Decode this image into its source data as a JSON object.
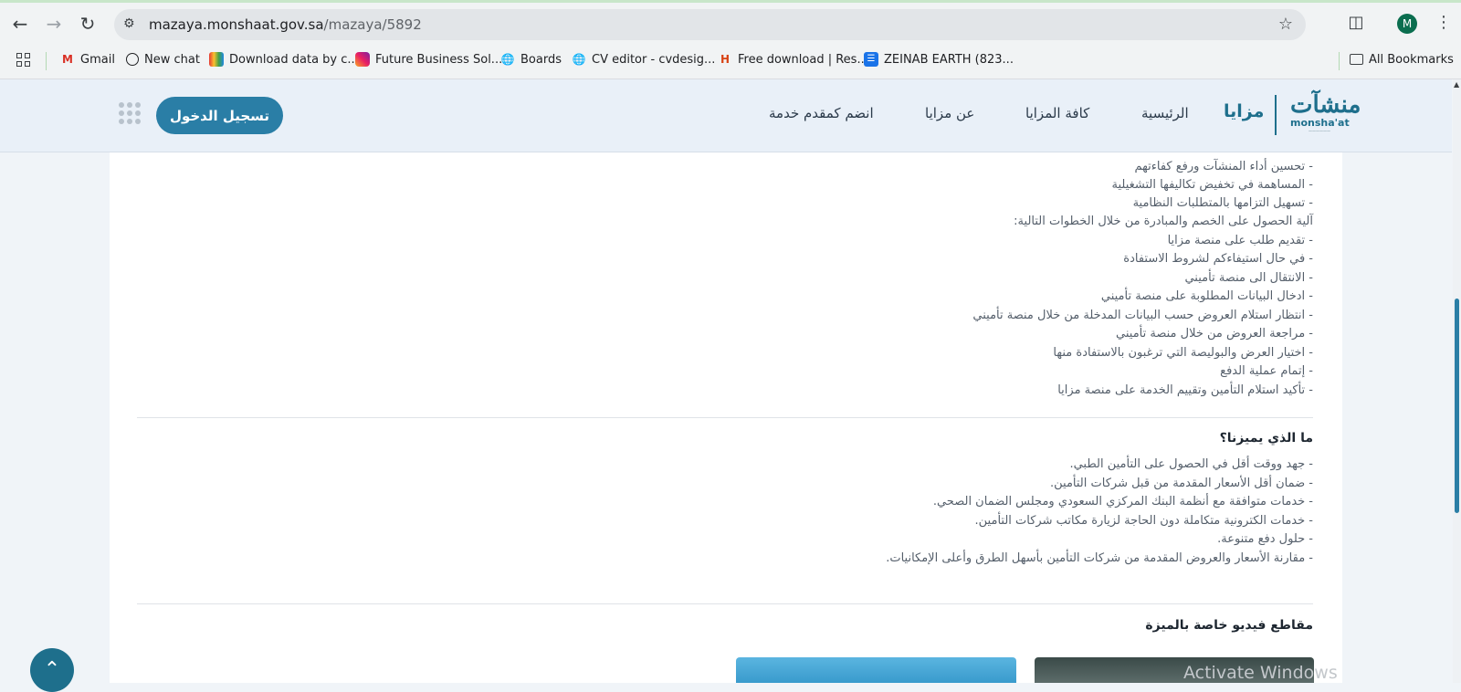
{
  "browser": {
    "url_domain": "mazaya.monshaat.gov.sa",
    "url_path": "/mazaya/5892",
    "profile_initial": "M",
    "bookmarks": [
      "Gmail",
      "New chat",
      "Download data by c...",
      "Future Business Sol...",
      "Boards",
      "CV editor - cvdesig...",
      "Free download | Res...",
      "ZEINAB EARTH (823..."
    ],
    "all_bookmarks": "All Bookmarks"
  },
  "header": {
    "logo_ar": "منشآت",
    "logo_en": "monsha'at",
    "brand": "مزايا",
    "menu": [
      "الرئيسية",
      "كافة المزايا",
      "عن مزايا",
      "انضم كمقدم خدمة"
    ],
    "login": "تسجيل الدخول"
  },
  "content": {
    "list1": [
      "- تحسين أداء المنشآت ورفع كفاءتهم",
      "- المساهمة في تخفيض تكاليفها التشغيلية",
      "- تسهيل التزامها بالمتطلبات النظامية",
      "آلية الحصول على الخصم والمبادرة من خلال الخطوات التالية:",
      "- تقديم طلب على منصة مزايا",
      "- في حال استيفاءكم لشروط الاستفادة",
      "- الانتقال الى منصة تأميني",
      "- ادخال البيانات المطلوبة على منصة تأميني",
      "- انتظار استلام العروض حسب البيانات المدخلة من خلال منصة تأميني",
      "- مراجعة العروض من خلال منصة تأميني",
      "- اختيار العرض والبوليصة التي ترغبون بالاستفادة منها",
      "- إتمام عملية الدفع",
      "- تأكيد استلام التأمين وتقييم الخدمة على منصة مزايا"
    ],
    "section2_title": "ما الذي يميزنا؟",
    "list2": [
      "- جهد ووقت أقل في الحصول على التأمين الطبي.",
      "- ضمان أقل الأسعار المقدمة من قبل شركات التأمين.",
      "- خدمات متوافقة مع أنظمة البنك المركزي السعودي ومجلس الضمان الصحي.",
      "- خدمات الكترونية متكاملة دون الحاجة لزيارة مكاتب شركات التأمين.",
      "- حلول دفع متنوعة.",
      "- مقارنة الأسعار والعروض المقدمة من شركات التأمين بأسهل الطرق وأعلى الإمكانيات."
    ],
    "section3_title": "مقاطع فيديو خاصة بالميزة"
  },
  "watermark": "Activate Windows",
  "colors": {
    "primary": "#2a7ea6",
    "logo": "#1e6f8c",
    "header_bg": "#e9f0f8"
  }
}
